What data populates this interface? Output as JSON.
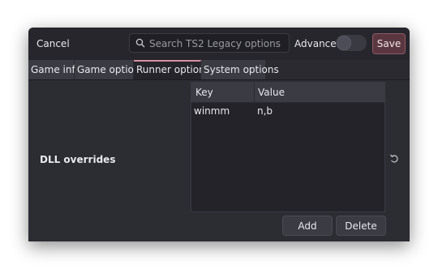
{
  "header": {
    "cancel_label": "Cancel",
    "search_placeholder": "Search TS2 Legacy options",
    "advanced_label": "Advanced",
    "advanced_enabled": false,
    "save_label": "Save"
  },
  "tabs": [
    {
      "label": "Game info",
      "active": false
    },
    {
      "label": "Game options",
      "active": false
    },
    {
      "label": "Runner options",
      "active": true
    },
    {
      "label": "System options",
      "active": false
    }
  ],
  "dll_overrides": {
    "label": "DLL overrides",
    "columns": {
      "key": "Key",
      "value": "Value"
    },
    "rows": [
      {
        "key": "winmm",
        "value": "n,b"
      }
    ],
    "add_label": "Add",
    "delete_label": "Delete"
  },
  "colors": {
    "accent": "#d88fa0",
    "save_bg": "#5a3740",
    "window_bg": "#2c2c33"
  }
}
